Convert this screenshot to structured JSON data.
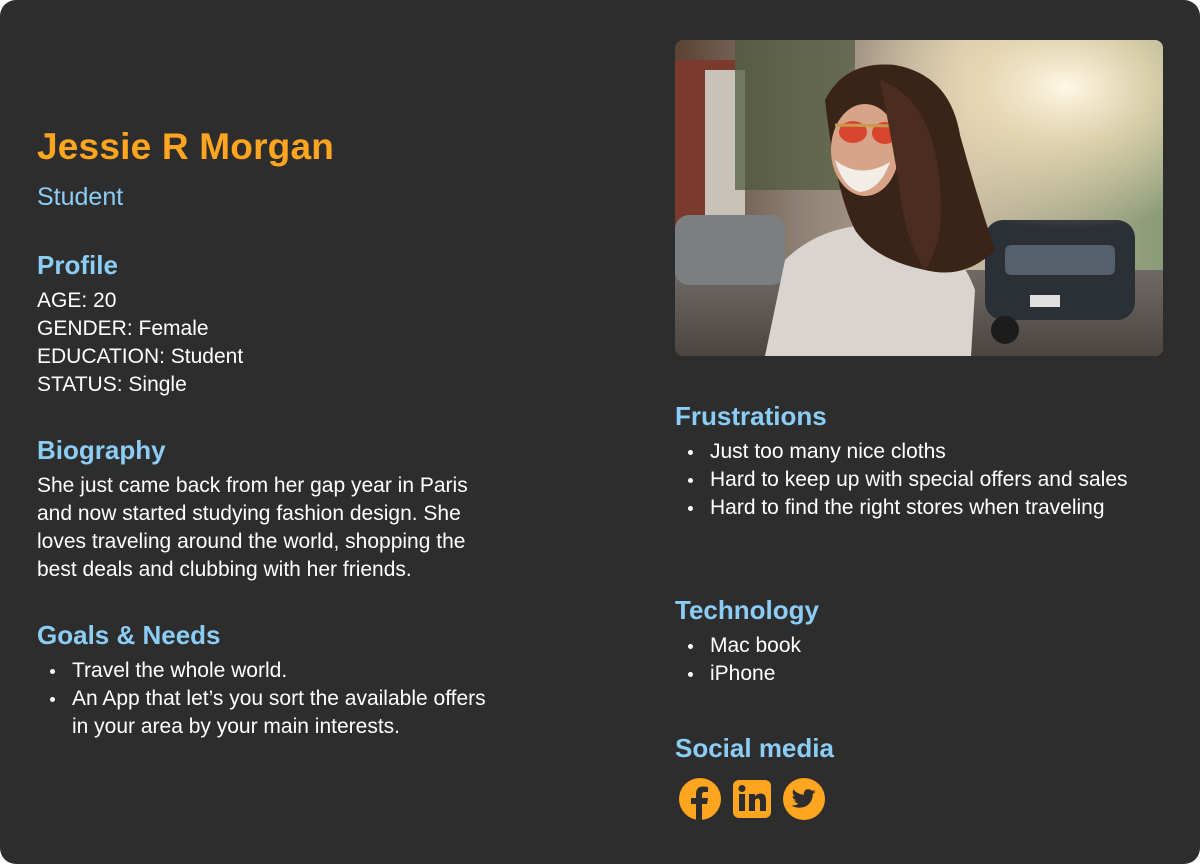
{
  "persona": {
    "name": "Jessie R Morgan",
    "role": "Student"
  },
  "profile": {
    "heading": "Profile",
    "lines": [
      "AGE: 20",
      "GENDER: Female",
      "EDUCATION: Student",
      "STATUS: Single"
    ]
  },
  "biography": {
    "heading": "Biography",
    "lines": [
      "She just came back from her gap year in Paris",
      "and now started studying fashion design. She",
      "loves traveling around the world, shopping the",
      "best deals and clubbing with her friends."
    ]
  },
  "goals": {
    "heading": "Goals & Needs",
    "items": [
      "Travel the whole world.",
      "An App that let’s you sort the available offers in your area by your main interests."
    ]
  },
  "frustrations": {
    "heading": "Frustrations",
    "items": [
      "Just too many nice cloths",
      "Hard to keep up with special offers and sales",
      "Hard to find the right stores when traveling"
    ]
  },
  "technology": {
    "heading": "Technology",
    "items": [
      "Mac book",
      "iPhone"
    ]
  },
  "social": {
    "heading": "Social media",
    "icons": [
      "facebook-icon",
      "linkedin-icon",
      "twitter-icon"
    ],
    "accent": "#ffa51f"
  },
  "colors": {
    "background": "#2d2d2d",
    "name": "#ffa51f",
    "heading": "#8ccdf5",
    "text": "#ffffff"
  }
}
